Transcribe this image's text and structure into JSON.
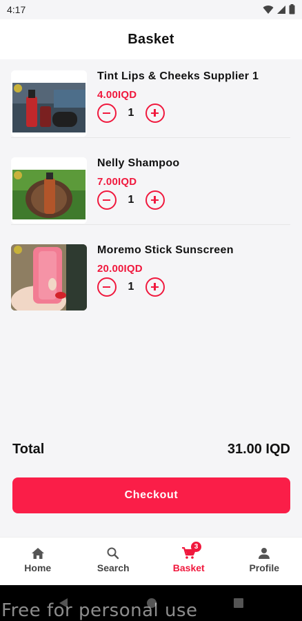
{
  "status_bar": {
    "time": "4:17"
  },
  "header": {
    "title": "Basket"
  },
  "items": [
    {
      "name": "Tint Lips & Cheeks Supplier 1",
      "price": "4.00IQD",
      "quantity": "1"
    },
    {
      "name": "Nelly Shampoo",
      "price": "7.00IQD",
      "quantity": "1"
    },
    {
      "name": "Moremo Stick Sunscreen",
      "price": "20.00IQD",
      "quantity": "1"
    }
  ],
  "total": {
    "label": "Total",
    "value": "31.00 IQD"
  },
  "checkout": {
    "label": "Checkout"
  },
  "nav": {
    "items": [
      {
        "label": "Home",
        "icon": "home-icon"
      },
      {
        "label": "Search",
        "icon": "search-icon"
      },
      {
        "label": "Basket",
        "icon": "cart-icon",
        "badge": "3",
        "active": true
      },
      {
        "label": "Profile",
        "icon": "person-icon"
      }
    ]
  },
  "watermark": "Free for personal use",
  "colors": {
    "accent": "#f0183d",
    "button": "#fa1e48",
    "background": "#f5f5f7"
  }
}
